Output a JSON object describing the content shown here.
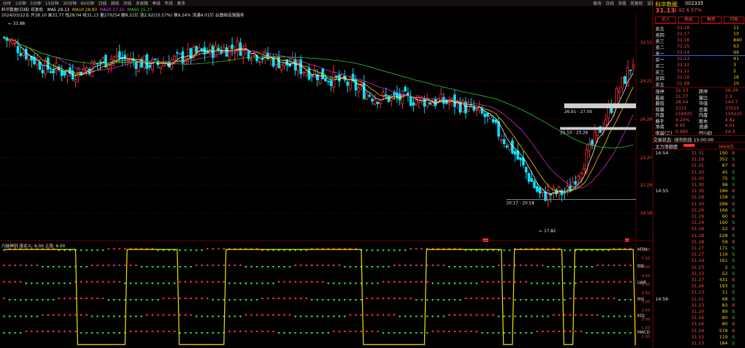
{
  "toolbar": [
    "分时",
    "1分钟",
    "5分钟",
    "15分钟",
    "30分钟",
    "60分钟",
    "日线",
    "周线",
    "月线",
    "多周期",
    "季线",
    "年线",
    "更多"
  ],
  "toolbar_right": [
    "板块",
    "日线",
    "多股",
    "前复权",
    "设置"
  ],
  "main_chart": {
    "title": "科华数据(日线) 前复权",
    "ma_line": [
      {
        "text": "MA5 29.13",
        "color": "#ffffff"
      },
      {
        "text": "MA10 28.83",
        "color": "#ffd700"
      },
      {
        "text": "MA20 27.55",
        "color": "#ff44ff"
      },
      {
        "text": "MA60 25.37",
        "color": "#33dd33"
      }
    ],
    "info_line": "2024/03/22五  开28.10 高31.77 低28.04 收31.13 量270254 额8.21亿 涨2.92(10.57%) 换9.24% 流通4.01亿 云基础设施服务",
    "price_labels": [
      "32.13",
      "29.21",
      "26.29",
      "23.37",
      "21.29",
      "19.18"
    ],
    "annotations": {
      "high": "33.88",
      "low": "17.82",
      "box1": "26.91 - 27.00",
      "box2": "25.10 - 25.26",
      "range1": "20.17 - 20.18"
    },
    "markers": [
      "B",
      "B",
      "S"
    ]
  },
  "indicator": {
    "title": "六脉神剑 涨买入: 6.00 上涨: 6.00",
    "rows": [
      "MTM",
      "BBI",
      "LWR",
      "RSI",
      "KDJ",
      "MACD"
    ],
    "axis": [
      "6.00",
      "5.50",
      "5.00",
      "4.50",
      "4.00",
      "3.50",
      "3.00",
      "2.50",
      "2.00",
      "1.50",
      "1.00"
    ],
    "flip_cols": [
      0,
      26,
      44,
      63,
      80,
      130,
      153,
      181,
      185,
      203,
      207,
      229
    ]
  },
  "panel": {
    "stock_name": "科华数据",
    "stock_code": "002335",
    "price": "31.13",
    "change": "1.92",
    "pct": "6.57%",
    "buttons": [
      "买入",
      "卖出",
      "融资",
      "闪电"
    ],
    "order_book": [
      {
        "label": "卖五",
        "price": "31.18",
        "vol": "11"
      },
      {
        "label": "卖四",
        "price": "31.17",
        "vol": "10"
      },
      {
        "label": "卖三",
        "price": "31.16",
        "vol": "840"
      },
      {
        "label": "卖二",
        "price": "31.15",
        "vol": "63"
      },
      {
        "label": "卖一",
        "price": "31.14",
        "vol": "99"
      },
      {
        "label": "买一",
        "price": "31.13",
        "vol": "41"
      },
      {
        "label": "买二",
        "price": "31.12",
        "vol": "3"
      },
      {
        "label": "买三",
        "price": "31.11",
        "vol": "2"
      },
      {
        "label": "买四",
        "price": "31.10",
        "vol": "16"
      },
      {
        "label": "买五",
        "price": "31.09",
        "vol": "10"
      }
    ],
    "stats": [
      {
        "k1": "涨停",
        "v1": "32.13",
        "k2": "跌停",
        "v2": "26.29"
      },
      {
        "k1": "最高",
        "v1": "31.77",
        "k2": "量比",
        "v2": "2.3"
      },
      {
        "k1": "最低",
        "v1": "28.04",
        "k2": "市值",
        "v2": "143.7"
      },
      {
        "k1": "现量",
        "v1": "2331",
        "k2": "总量",
        "v2": "37025"
      },
      {
        "k1": "外盘",
        "v1": "216825",
        "k2": "内盘",
        "v2": "154225"
      },
      {
        "k1": "换手",
        "v1": "9.24%",
        "k2": "股本",
        "v2": "4.62"
      },
      {
        "k1": "净资",
        "v1": "8.95",
        "k2": "流通",
        "v2": "4.01"
      },
      {
        "k1": "收益(三)",
        "v1": "0.960",
        "k2": "PE(动)",
        "v2": "24.3"
      }
    ],
    "status": "交易状态: 闭市阶段 15:00:00",
    "main_net": "主力净额度",
    "main_net_val": "3669万",
    "ticks": [
      {
        "t": "14:54",
        "p": "31.31",
        "v": "190",
        "s": "B"
      },
      {
        "t": "",
        "p": "31.29",
        "v": "352",
        "s": "S"
      },
      {
        "t": "",
        "p": "31.31",
        "v": "87",
        "s": "B"
      },
      {
        "t": "",
        "p": "31.30",
        "v": "45",
        "s": "S"
      },
      {
        "t": "",
        "p": "31.30",
        "v": "75",
        "s": "S"
      },
      {
        "t": "",
        "p": "31.30",
        "v": "98",
        "s": "S"
      },
      {
        "t": "14:55",
        "p": "31.30",
        "v": "186",
        "s": "B"
      },
      {
        "t": "",
        "p": "31.29",
        "v": "158",
        "s": "S"
      },
      {
        "t": "",
        "p": "31.30",
        "v": "288",
        "s": "B"
      },
      {
        "t": "",
        "p": "31.29",
        "v": "166",
        "s": "S"
      },
      {
        "t": "",
        "p": "31.29",
        "v": "60",
        "s": "B"
      },
      {
        "t": "",
        "p": "31.29",
        "v": "190",
        "s": "S"
      },
      {
        "t": "",
        "p": "31.28",
        "v": "22",
        "s": "B"
      },
      {
        "t": "",
        "p": "31.28",
        "v": "228",
        "s": "S"
      },
      {
        "t": "",
        "p": "31.28",
        "v": "59",
        "s": "B"
      },
      {
        "t": "",
        "p": "31.27",
        "v": "171",
        "s": "S"
      },
      {
        "t": "",
        "p": "31.27",
        "v": "116",
        "s": "S"
      },
      {
        "t": "",
        "p": "31.24",
        "v": "161",
        "s": "S"
      },
      {
        "t": "",
        "p": "31.23",
        "v": "2",
        "s": "S"
      },
      {
        "t": "",
        "p": "31.23",
        "v": "52",
        "s": "S"
      },
      {
        "t": "",
        "p": "31.27",
        "v": "431",
        "s": "B"
      },
      {
        "t": "",
        "p": "31.26",
        "v": "193",
        "s": "S"
      },
      {
        "t": "",
        "p": "31.23",
        "v": "11",
        "s": "S"
      },
      {
        "t": "14:56",
        "p": "31.21",
        "v": "68",
        "s": "S"
      },
      {
        "t": "",
        "p": "31.23",
        "v": "83",
        "s": "B"
      },
      {
        "t": "",
        "p": "31.20",
        "v": "89",
        "s": "S"
      },
      {
        "t": "",
        "p": "31.16",
        "v": "80",
        "s": "S"
      },
      {
        "t": "",
        "p": "31.16",
        "v": "80",
        "s": "B"
      },
      {
        "t": "",
        "p": "31.24",
        "v": "578",
        "s": "B"
      },
      {
        "t": "",
        "p": "31.15",
        "v": "119",
        "s": "S"
      },
      {
        "t": "",
        "p": "31.13",
        "v": "184",
        "s": "S"
      }
    ]
  },
  "colors": {
    "up": "#ff3333",
    "down": "#00e5ff",
    "ma5": "#ffffff",
    "ma10": "#ffd700",
    "ma20": "#cc33cc",
    "ma60": "#33cc33",
    "signal": "#ffee00"
  }
}
